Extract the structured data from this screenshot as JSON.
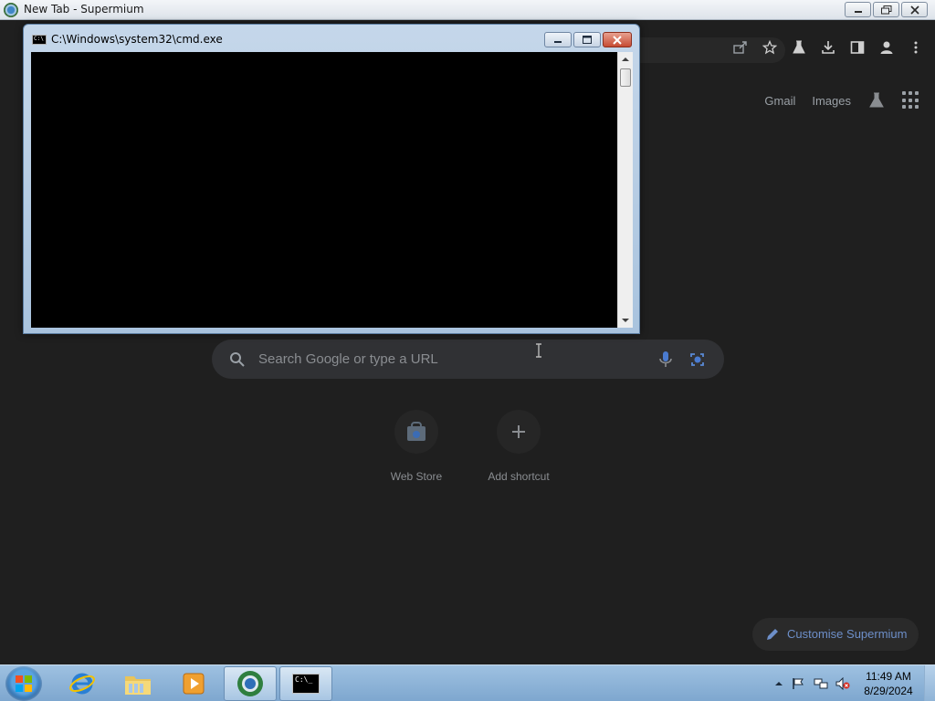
{
  "browser": {
    "window_title": "New Tab - Supermium"
  },
  "ntp": {
    "gmail_label": "Gmail",
    "images_label": "Images",
    "search_placeholder": "Search Google or type a URL",
    "shortcuts": [
      {
        "label": "Web Store",
        "icon": "web-store-icon"
      },
      {
        "label": "Add shortcut",
        "icon": "plus-icon"
      }
    ],
    "customise_label": "Customise Supermium",
    "accent_color": "#6d8fc9"
  },
  "cmd": {
    "title": "C:\\Windows\\system32\\cmd.exe",
    "icon_text": "C:\\"
  },
  "taskbar": {
    "apps": [
      {
        "name": "internet-explorer",
        "active": false
      },
      {
        "name": "windows-explorer",
        "active": false
      },
      {
        "name": "media-player",
        "active": false
      },
      {
        "name": "supermium",
        "active": true
      },
      {
        "name": "cmd",
        "active": true
      }
    ],
    "cmd_icon_text": "C:\\_",
    "time": "11:49 AM",
    "date": "8/29/2024"
  }
}
